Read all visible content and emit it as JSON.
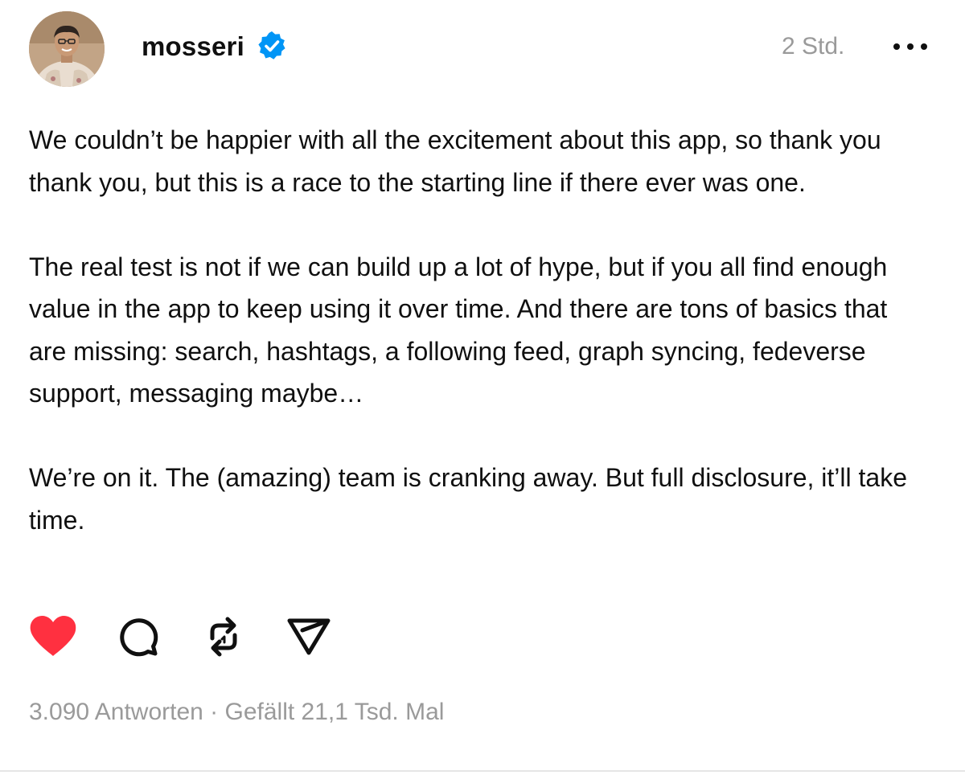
{
  "post": {
    "author": {
      "username": "mosseri",
      "verified": true,
      "avatar": "profile-photo"
    },
    "timestamp": "2 Std.",
    "paragraphs": [
      "We couldn’t be happier with all the excitement about this app, so thank you thank you, but this is a race to the starting line if there ever was one.",
      "The real test is not if we can build up a lot of hype, but if you all find enough value in the app to keep using it over time. And there are tons of basics that are missing: search, hashtags, a following feed, graph syncing, fedeverse support, messaging maybe…",
      "We’re on it. The (amazing) team is cranking away. But full disclosure, it’ll take time."
    ],
    "actions": {
      "like": {
        "icon": "heart-icon",
        "liked": true,
        "color": "#ff3040"
      },
      "reply": {
        "icon": "speech-bubble-icon"
      },
      "repost": {
        "icon": "repost-icon"
      },
      "share": {
        "icon": "paper-plane-icon"
      }
    },
    "stats": {
      "replies": "3.090 Antworten",
      "separator": " · ",
      "likes": "Gefällt 21,1 Tsd. Mal"
    }
  },
  "colors": {
    "text": "#101010",
    "muted": "#9a9a9a",
    "verified_badge": "#0095f6",
    "like": "#ff3040"
  }
}
